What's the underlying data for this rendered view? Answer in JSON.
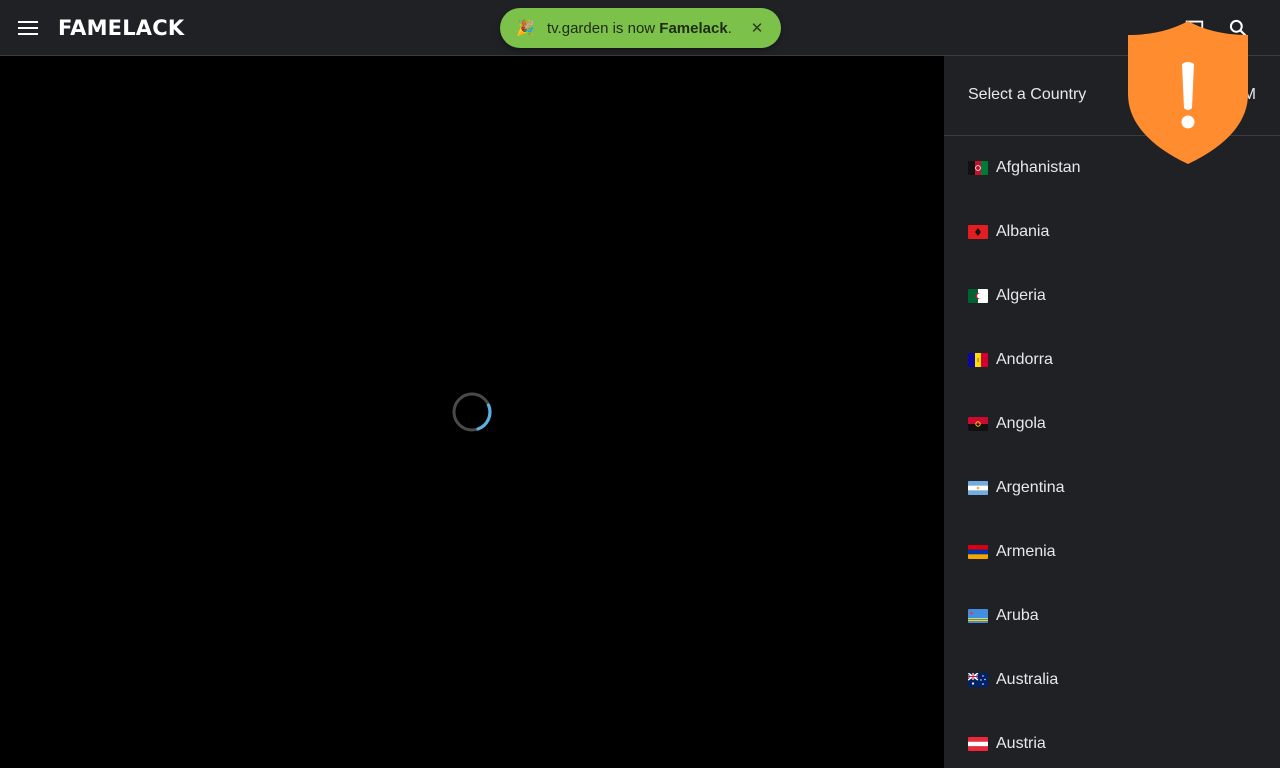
{
  "header": {
    "logo": "FAMELACK",
    "menu_icon": "menu-icon",
    "cast_icon": "cast-icon",
    "search_icon": "search-icon"
  },
  "toast": {
    "emoji": "🎉",
    "text_prefix": "tv.garden is now ",
    "text_brand": "Famelack",
    "text_suffix": ".",
    "close_label": "✕",
    "color": "#7cc24a"
  },
  "player": {
    "spinner_icon": "loading-spinner-icon",
    "spinner_color": "#5ab0e0"
  },
  "country_panel": {
    "title": "Select a Country",
    "extra_text": "M",
    "countries": [
      {
        "name": "Afghanistan",
        "flag": "afghanistan-flag-icon"
      },
      {
        "name": "Albania",
        "flag": "albania-flag-icon"
      },
      {
        "name": "Algeria",
        "flag": "algeria-flag-icon"
      },
      {
        "name": "Andorra",
        "flag": "andorra-flag-icon"
      },
      {
        "name": "Angola",
        "flag": "angola-flag-icon"
      },
      {
        "name": "Argentina",
        "flag": "argentina-flag-icon"
      },
      {
        "name": "Armenia",
        "flag": "armenia-flag-icon"
      },
      {
        "name": "Aruba",
        "flag": "aruba-flag-icon"
      },
      {
        "name": "Australia",
        "flag": "australia-flag-icon"
      },
      {
        "name": "Austria",
        "flag": "austria-flag-icon"
      }
    ]
  },
  "overlay": {
    "shield_icon": "warning-shield-icon",
    "shield_color": "#ff8c2e"
  }
}
